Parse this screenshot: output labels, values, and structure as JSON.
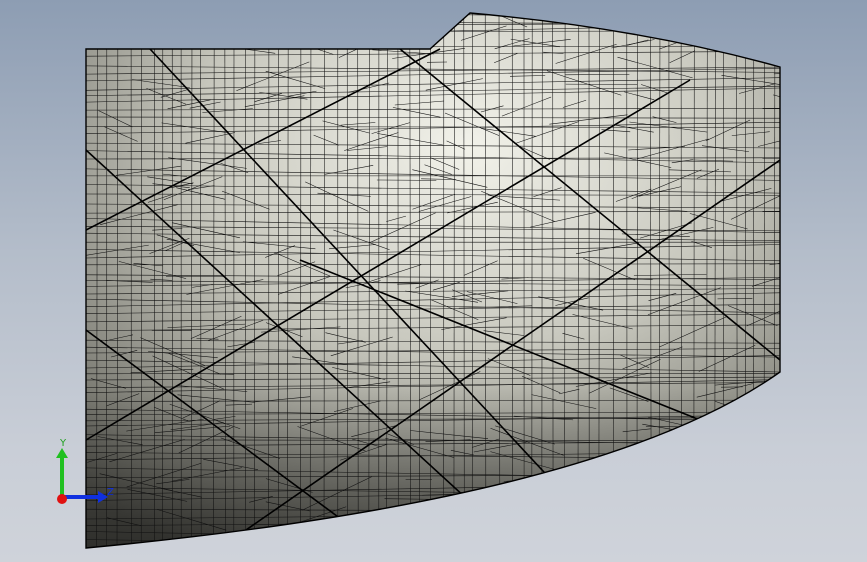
{
  "viewport": {
    "background_top": "#8d9db3",
    "background_bottom": "#cfd3da",
    "model": {
      "name": "meshed-surface-part",
      "display_mode": "shaded-with-edges",
      "mesh_color": "#000000",
      "surface_color": "#c4c5bb"
    }
  },
  "triad": {
    "y_label": "Y",
    "z_label": "Z",
    "x_color": "#e01010",
    "y_color": "#20c020",
    "z_color": "#1030e0"
  }
}
